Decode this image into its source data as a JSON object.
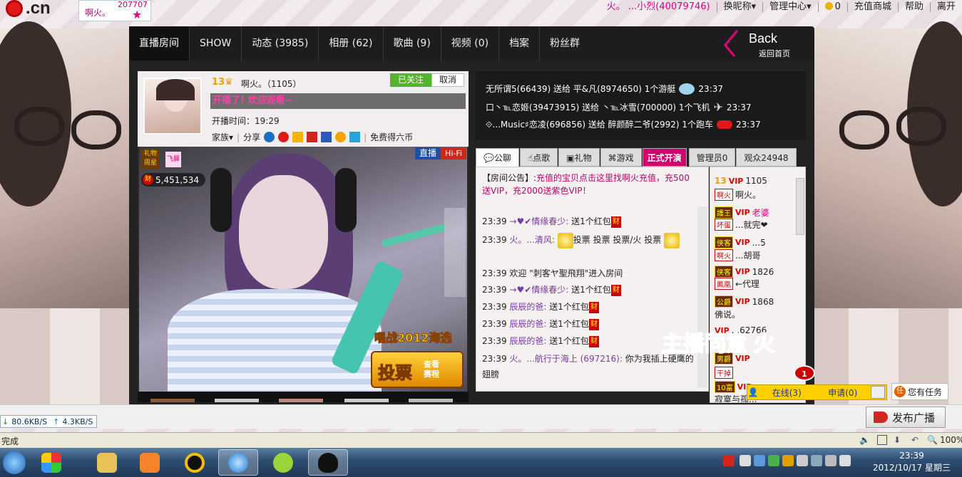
{
  "site": {
    "logo_text": ".cn"
  },
  "anchor_badge": {
    "name": "啊火。",
    "count": "207707"
  },
  "top_menu": {
    "user": "火。 ...小烈(40079746)",
    "items": [
      "换昵称▾",
      "管理中心▾",
      "0",
      "充值商城",
      "帮助",
      "离开"
    ]
  },
  "nav": {
    "tabs": [
      "直播房间",
      "SHOW",
      "动态 (3985)",
      "相册 (62)",
      "歌曲 (9)",
      "视频 (0)",
      "档案",
      "粉丝群"
    ],
    "back_title": "Back",
    "back_sub": "返回首页"
  },
  "anchor_info": {
    "level": "13",
    "name": "啊火。（1105）",
    "followed": "已关注",
    "cancel": "取消",
    "banner": "开播了! 欢迎观看~",
    "start_time_label": "开播时间：19:29",
    "family": "家族▾",
    "share": "分享",
    "free_coins": "免费得六币"
  },
  "video": {
    "gift_star": "礼物周星",
    "fly": "飞屏",
    "coin_count": "5,451,534",
    "live_label": "直播",
    "hifi_label": "Hi-Fi",
    "promo_title": "唱战2012海选",
    "vote_label": "投票",
    "vote_sub": "查看赛程"
  },
  "gift_feed": [
    {
      "text": "无所谓5(66439) 送给 平&凡(8974650) 1个游艇",
      "time": "23:37"
    },
    {
      "text": "口丶℡恋姬(39473915) 送给 丶℡冰雪(700000) 1个飞机",
      "time": "23:37"
    },
    {
      "text": "⟐...Music♯恋凌(696856) 送给 醉颜醉二爷(2992) 1个跑车",
      "time": "23:37"
    }
  ],
  "chat_tabs": [
    "公聊",
    "点歌",
    "礼物",
    "游戏",
    "正式开演",
    "管理员0",
    "观众24948"
  ],
  "notice": {
    "label": "【房间公告】:",
    "text": "充值的宝贝点击这里找啊火充值，充500送VIP，充2000送紫色VIP！"
  },
  "chat": [
    {
      "time": "23:39",
      "user": "→♥✔情缘春少:",
      "text": "送1个红包"
    },
    {
      "time": "23:39",
      "user": "火。...清风:",
      "text": "投票 投票 投票/火 投票"
    },
    {
      "time": "23:39",
      "user": "",
      "text": "欢迎 \"刺客ヤ聖飛翔\"进入房间"
    },
    {
      "time": "23:39",
      "user": "→♥✔情缘春少:",
      "text": "送1个红包"
    },
    {
      "time": "23:39",
      "user": "辰辰的爸:",
      "text": "送1个红包"
    },
    {
      "time": "23:39",
      "user": "辰辰的爸:",
      "text": "送1个红包"
    },
    {
      "time": "23:39",
      "user": "辰辰的爸:",
      "text": "送1个红包"
    },
    {
      "time": "23:39",
      "user": "火。...航行于海上 (697216):",
      "text": "你为我插上硬鹰的翅膀"
    }
  ],
  "users": [
    {
      "level": "13",
      "vip": "VIP",
      "text": "1105"
    },
    {
      "level": "啊火",
      "vip": "",
      "text": "啊火。"
    },
    {
      "level": "護王",
      "vip": "VIP",
      "text": "老婆"
    },
    {
      "level": "坏蛋",
      "vip": "",
      "text": "...就完❤"
    },
    {
      "level": "侠客",
      "vip": "VIP",
      "text": "...5"
    },
    {
      "level": "啊火",
      "vip": "",
      "text": "...胡哥"
    },
    {
      "level": "侠客",
      "vip": "VIP",
      "text": "1826"
    },
    {
      "level": "鳳凰",
      "vip": "",
      "text": "←代理"
    },
    {
      "level": "公爵",
      "vip": "VIP",
      "text": "1868"
    },
    {
      "level": "",
      "vip": "",
      "text": "佛说。"
    },
    {
      "level": "",
      "vip": "VIP",
      "text": "...62766"
    },
    {
      "level": "男爵",
      "vip": "VIP",
      "text": ""
    },
    {
      "level": "干掉",
      "vip": "",
      "text": ""
    },
    {
      "level": "10富",
      "vip": "VIP",
      "text": ""
    },
    {
      "level": "",
      "vip": "",
      "text": "寂寞与孤..."
    }
  ],
  "overlay_text": "主播同意 火",
  "online_bar": {
    "online": "在线(3)",
    "apply": "申请(0)",
    "notif": "1"
  },
  "task_btn": "您有任务",
  "broadcast": {
    "upload_speed": "80.6KB/S",
    "download_speed": "4.3KB/S",
    "publish": "发布广播"
  },
  "status": {
    "text": "完成",
    "zoom": "100%"
  },
  "clock": {
    "time": "23:39",
    "date": "2012/10/17 星期三"
  },
  "colors": {
    "accent": "#e6007e",
    "nav_bg": "#1d1d1d",
    "vip": "#d80000"
  }
}
